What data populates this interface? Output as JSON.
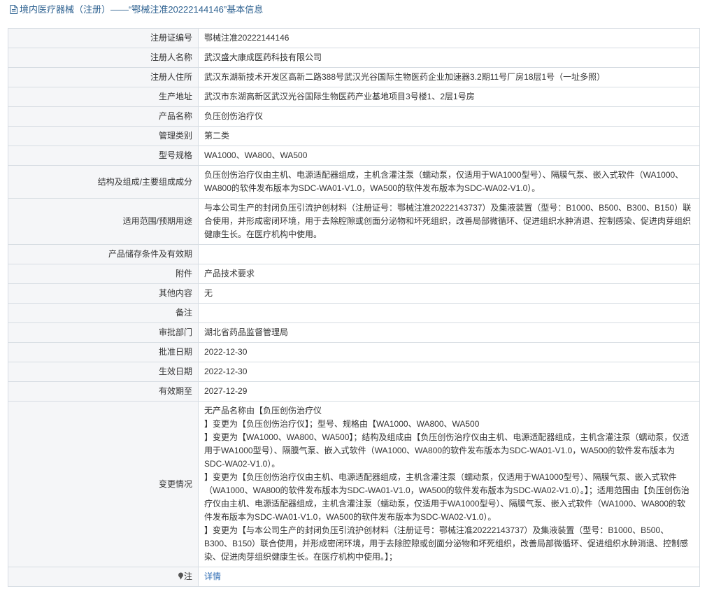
{
  "header": {
    "icon": "document-icon",
    "title": "境内医疗器械（注册）——“鄂械注准20222144146”基本信息"
  },
  "rows": [
    {
      "label": "注册证编号",
      "value": "鄂械注准20222144146"
    },
    {
      "label": "注册人名称",
      "value": "武汉盛大康成医药科技有限公司"
    },
    {
      "label": "注册人住所",
      "value": "武汉东湖新技术开发区高新二路388号武汉光谷国际生物医药企业加速器3.2期11号厂房18层1号（一址多照）"
    },
    {
      "label": "生产地址",
      "value": "武汉市东湖高新区武汉光谷国际生物医药产业基地项目3号楼1、2层1号房"
    },
    {
      "label": "产品名称",
      "value": "负压创伤治疗仪"
    },
    {
      "label": "管理类别",
      "value": "第二类"
    },
    {
      "label": "型号规格",
      "value": "WA1000、WA800、WA500"
    },
    {
      "label": "结构及组成/主要组成成分",
      "value": "负压创伤治疗仪由主机、电源适配器组成，主机含灌注泵（蠕动泵，仅适用于WA1000型号）、隔膜气泵、嵌入式软件（WA1000、WA800的软件发布版本为SDC-WA01-V1.0，WA500的软件发布版本为SDC-WA02-V1.0）。"
    },
    {
      "label": "适用范围/预期用途",
      "value": "与本公司生产的封闭负压引流护创材料（注册证号：鄂械注准20222143737）及集液装置（型号：B1000、B500、B300、B150）联合使用，并形成密闭环境，用于去除腔隙或创面分泌物和坏死组织，改善局部微循环、促进组织水肿消退、控制感染、促进肉芽组织健康生长。在医疗机构中使用。"
    },
    {
      "label": "产品储存条件及有效期",
      "value": ""
    },
    {
      "label": "附件",
      "value": "产品技术要求"
    },
    {
      "label": "其他内容",
      "value": "无"
    },
    {
      "label": "备注",
      "value": ""
    },
    {
      "label": "审批部门",
      "value": "湖北省药品监督管理局"
    },
    {
      "label": "批准日期",
      "value": "2022-12-30"
    },
    {
      "label": "生效日期",
      "value": "2022-12-30"
    },
    {
      "label": "有效期至",
      "value": "2027-12-29"
    }
  ],
  "changes": {
    "label": "变更情况",
    "lines": [
      "无产品名称由【负压创伤治疗仪",
      "】变更为【负压创伤治疗仪】；型号、规格由【WA1000、WA800、WA500",
      "】变更为【WA1000、WA800、WA500】；结构及组成由【负压创伤治疗仪由主机、电源适配器组成，主机含灌注泵（蠕动泵，仅适用于WA1000型号）、隔膜气泵、嵌入式软件（WA1000、WA800的软件发布版本为SDC-WA01-V1.0，WA500的软件发布版本为SDC-WA02-V1.0）。",
      "】变更为【负压创伤治疗仪由主机、电源适配器组成，主机含灌注泵（蠕动泵，仅适用于WA1000型号）、隔膜气泵、嵌入式软件（WA1000、WA800的软件发布版本为SDC-WA01-V1.0，WA500的软件发布版本为SDC-WA02-V1.0）。】；适用范围由【负压创伤治疗仪由主机、电源适配器组成，主机含灌注泵（蠕动泵，仅适用于WA1000型号）、隔膜气泵、嵌入式软件（WA1000、WA800的软件发布版本为SDC-WA01-V1.0，WA500的软件发布版本为SDC-WA02-V1.0）。",
      "】变更为【与本公司生产的封闭负压引流护创材料（注册证号：鄂械注准20222143737）及集液装置（型号：B1000、B500、B300、B150）联合使用，并形成密闭环境，用于去除腔隙或创面分泌物和坏死组织，改善局部微循环、促进组织水肿消退、控制感染、促进肉芽组织健康生长。在医疗机构中使用。】；"
    ]
  },
  "note": {
    "icon": "pin-icon",
    "label": "注",
    "link_text": "详情"
  }
}
